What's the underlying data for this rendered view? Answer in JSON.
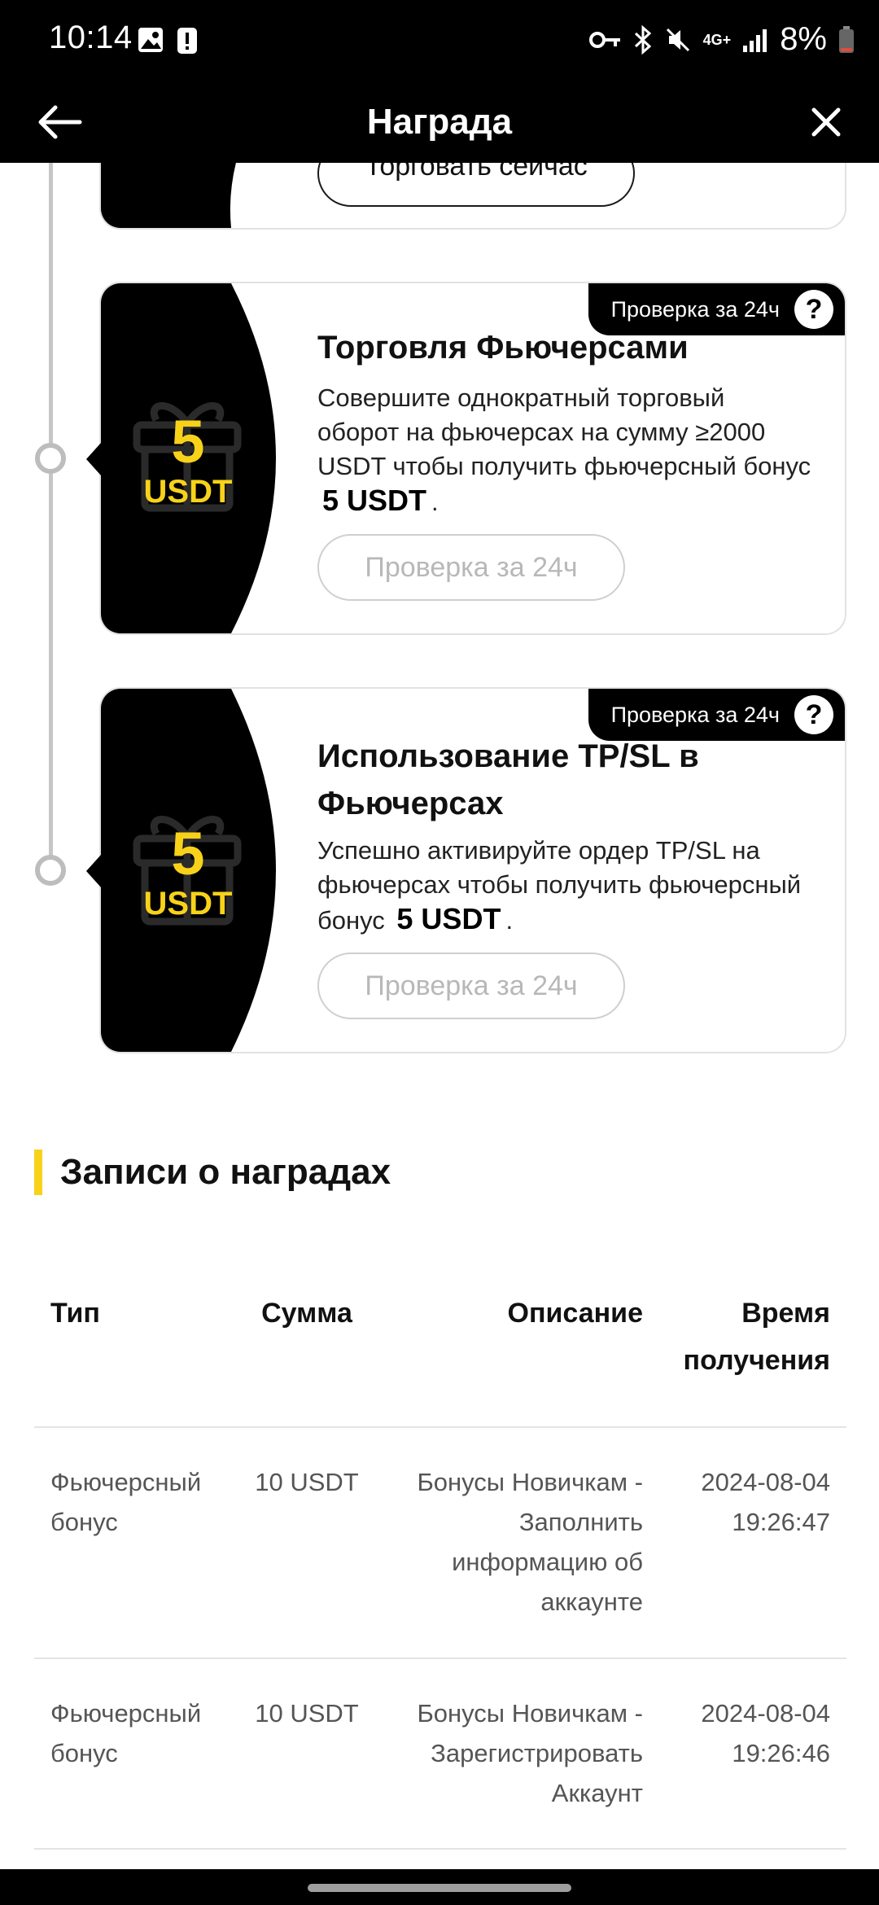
{
  "status_bar": {
    "time": "10:14",
    "battery": "8%",
    "network": "4G+"
  },
  "header": {
    "title": "Награда"
  },
  "tasks": [
    {
      "partial_button": "Торговать сейчас"
    },
    {
      "reward_amount": "5",
      "reward_unit": "USDT",
      "badge": "Проверка за 24ч",
      "title": "Торговля Фьючерсами",
      "desc_lines": [
        "Совершите однократный торговый",
        "оборот на фьючерсах на сумму ≥2000",
        "USDT чтобы получить фьючерсный бонус"
      ],
      "desc_amount": "5 USDT",
      "desc_end": ".",
      "button": "Проверка за 24ч"
    },
    {
      "reward_amount": "5",
      "reward_unit": "USDT",
      "badge": "Проверка за 24ч",
      "title_lines": [
        "Использование TP/SL в",
        "Фьючерсах"
      ],
      "desc_lines": [
        "Успешно активируйте ордер TP/SL на",
        "фьючерсах чтобы получить фьючерсный"
      ],
      "desc_prefix": "бонус",
      "desc_amount": "5 USDT",
      "desc_end": ".",
      "button": "Проверка за 24ч"
    }
  ],
  "records": {
    "title": "Записи о наградах",
    "columns": {
      "type": "Тип",
      "amount": "Сумма",
      "description": "Описание",
      "time_lines": [
        "Время",
        "получения"
      ]
    },
    "rows": [
      {
        "type_lines": [
          "Фьючерсный",
          "бонус"
        ],
        "amount": "10 USDT",
        "desc_lines": [
          "Бонусы Новичкам -",
          "Заполнить",
          "информацию об",
          "аккаунте"
        ],
        "time_lines": [
          "2024-08-04",
          "19:26:47"
        ]
      },
      {
        "type_lines": [
          "Фьючерсный",
          "бонус"
        ],
        "amount": "10 USDT",
        "desc_lines": [
          "Бонусы Новичкам -",
          "Зарегистрировать",
          "Аккаунт"
        ],
        "time_lines": [
          "2024-08-04",
          "19:26:46"
        ]
      }
    ]
  }
}
